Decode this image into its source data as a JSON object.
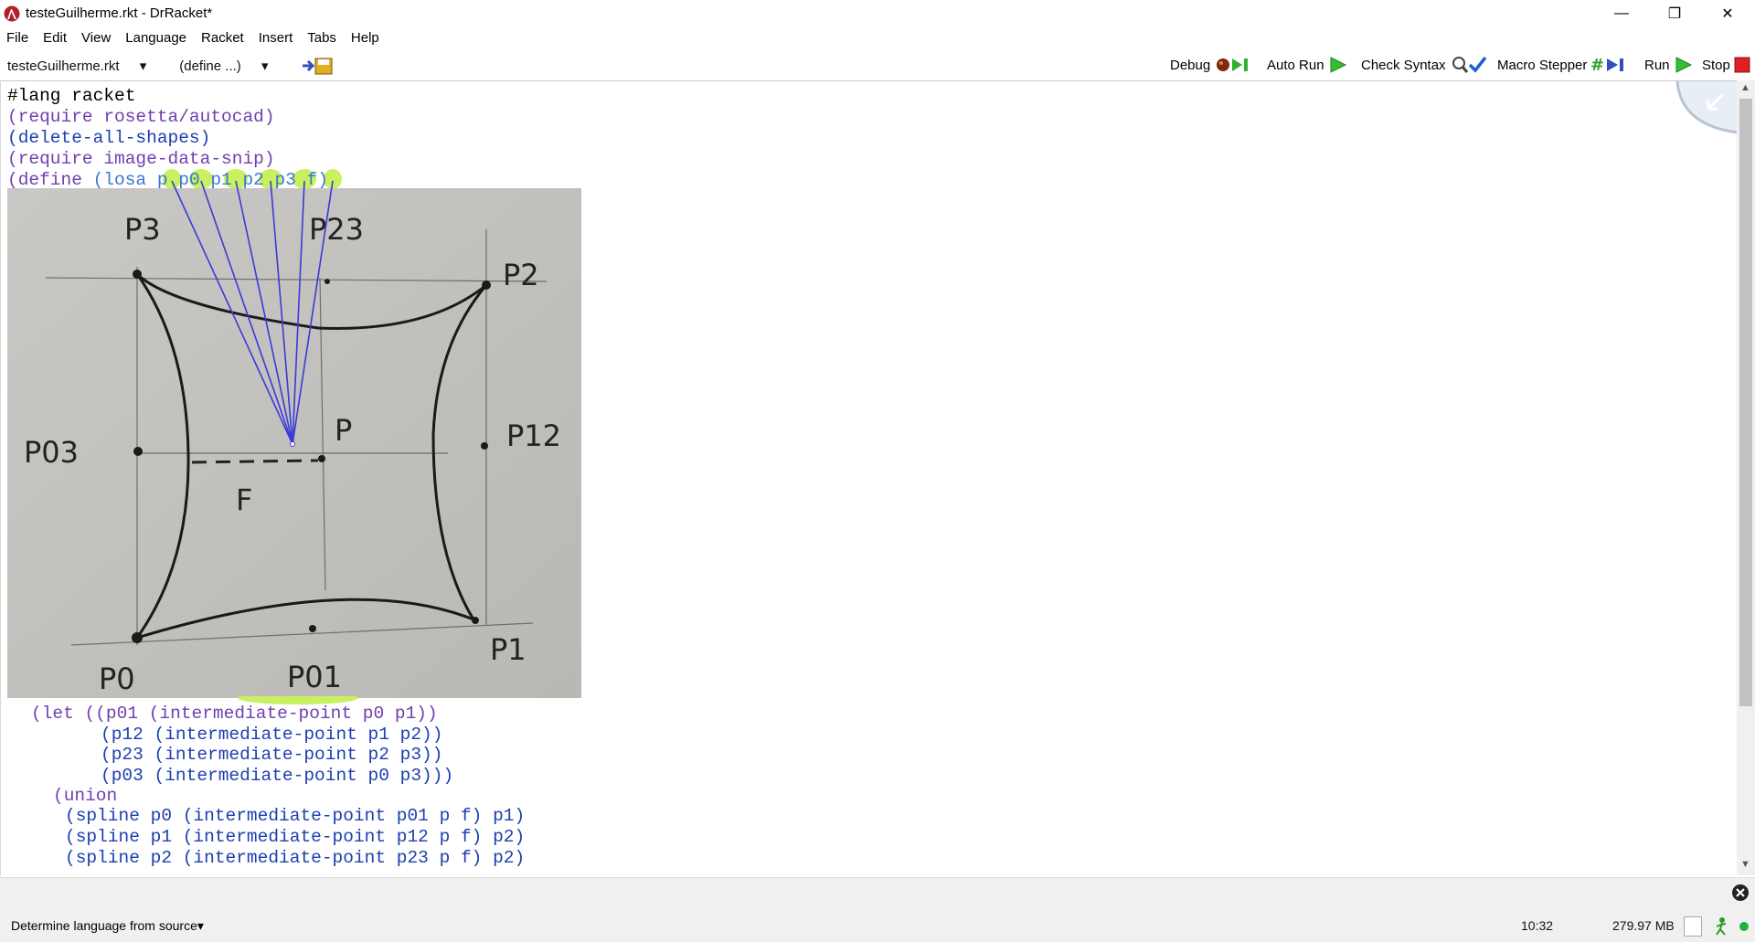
{
  "window": {
    "title": "testeGuilherme.rkt - DrRacket*",
    "minimize_glyph": "—",
    "maximize_glyph": "❐",
    "close_glyph": "✕"
  },
  "menu": [
    "File",
    "Edit",
    "View",
    "Language",
    "Racket",
    "Insert",
    "Tabs",
    "Help"
  ],
  "toolbar": {
    "file_dropdown": "testeGuilherme.rkt",
    "define_dropdown": "(define ...)",
    "debug_label": "Debug",
    "autorun_label": "Auto Run",
    "checksyntax_label": "Check Syntax",
    "macrostepper_label": "Macro Stepper",
    "run_label": "Run",
    "stop_label": "Stop"
  },
  "code_top": {
    "line1": "#lang racket",
    "line2": "(require rosetta/autocad)",
    "line3": "(delete-all-shapes)",
    "line4": "(require image-data-snip)",
    "line5_define": "(define",
    "line5_rest": " (losa p p0 p1 p2 p3 f)"
  },
  "code_bottom": {
    "l1": "(let ((p01 (intermediate-point p0 p1))",
    "l2": "(p12 (intermediate-point p1 p2))",
    "l3": "(p23 (intermediate-point p2 p3))",
    "l4": "(p03 (intermediate-point p0 p3)))",
    "l5": "(union",
    "l6": "(spline p0 (intermediate-point p01 p f) p1)",
    "l7": "(spline p1 (intermediate-point p12 p f) p2)",
    "l8": "(spline p2 (intermediate-point p23 p f) p2)"
  },
  "sketch_labels": {
    "p3": "P3",
    "p23": "P23",
    "p2": "P2",
    "p03": "P03",
    "p": "P",
    "f": "F",
    "p12": "P12",
    "p0": "P0",
    "p01": "P01",
    "p1": "P1"
  },
  "status": {
    "language": "Determine language from source",
    "position": "10:32",
    "memory": "279.97 MB"
  },
  "colors": {
    "keyword": "#7040b0",
    "paren": "#9a4a2a",
    "identifier": "#1c3fb0",
    "variable": "#3a78d6",
    "highlight": "#c8f060",
    "arrow": "#3a3ad8"
  }
}
